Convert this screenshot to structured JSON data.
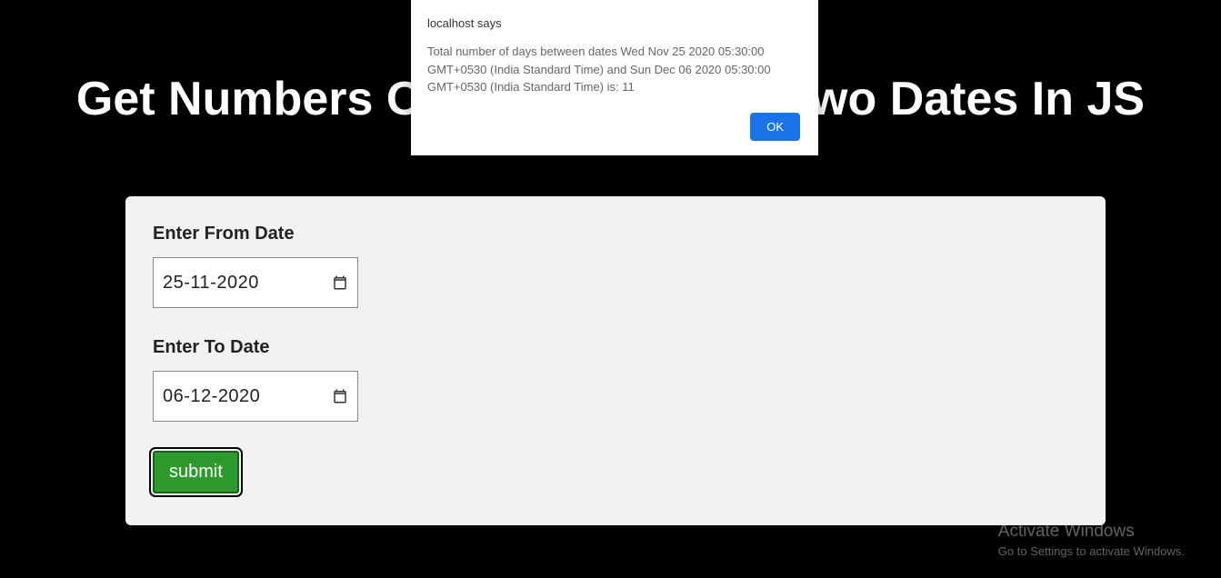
{
  "page": {
    "title": "Get Numbers Of Days Between Two Dates In JS"
  },
  "form": {
    "from": {
      "label": "Enter From Date",
      "value": "25-11-2020"
    },
    "to": {
      "label": "Enter To Date",
      "value": "06-12-2020"
    },
    "submit_label": "submit"
  },
  "alert": {
    "source": "localhost says",
    "message": "Total number of days between dates  Wed Nov 25 2020 05:30:00 GMT+0530 (India Standard Time) and Sun Dec 06 2020 05:30:00 GMT+0530 (India Standard Time) is:  11",
    "ok_label": "OK"
  },
  "watermark": {
    "title": "Activate Windows",
    "subtitle": "Go to Settings to activate Windows."
  }
}
